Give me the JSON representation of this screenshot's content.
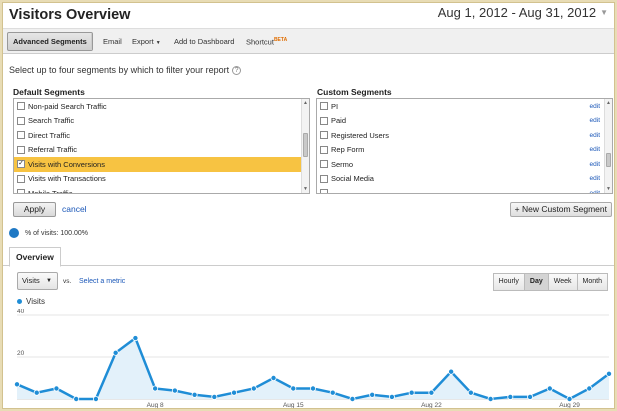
{
  "header": {
    "title": "Visitors Overview",
    "date_range": "Aug 1, 2012 - Aug 31, 2012"
  },
  "toolbar": {
    "advanced_segments": "Advanced Segments",
    "email": "Email",
    "export": "Export",
    "add_to_dashboard": "Add to Dashboard",
    "shortcut": "Shortcut",
    "beta": "BETA"
  },
  "segments": {
    "instruction": "Select up to four segments by which to filter your report",
    "default_heading": "Default Segments",
    "custom_heading": "Custom Segments",
    "default_items": [
      {
        "label": "Non-paid Search Traffic",
        "checked": false,
        "selected": false
      },
      {
        "label": "Search Traffic",
        "checked": false,
        "selected": false
      },
      {
        "label": "Direct Traffic",
        "checked": false,
        "selected": false
      },
      {
        "label": "Referral Traffic",
        "checked": false,
        "selected": false
      },
      {
        "label": "Visits with Conversions",
        "checked": true,
        "selected": true
      },
      {
        "label": "Visits with Transactions",
        "checked": false,
        "selected": false
      },
      {
        "label": "Mobile Traffic",
        "checked": false,
        "selected": false
      }
    ],
    "custom_items": [
      {
        "label": "PI",
        "edit": "edit"
      },
      {
        "label": "Paid",
        "edit": "edit"
      },
      {
        "label": "Registered Users",
        "edit": "edit"
      },
      {
        "label": "Rep Form",
        "edit": "edit"
      },
      {
        "label": "Sermo",
        "edit": "edit"
      },
      {
        "label": "Social Media",
        "edit": "edit"
      },
      {
        "label": "",
        "edit": "edit"
      }
    ],
    "apply": "Apply",
    "cancel": "cancel",
    "new_custom_segment": "+ New Custom Segment"
  },
  "summary": {
    "pct_visits": "% of visits: 100.00%"
  },
  "tabs": {
    "overview": "Overview"
  },
  "controls": {
    "metric": "Visits",
    "vs": "vs.",
    "select_metric": "Select a metric",
    "granularity": [
      "Hourly",
      "Day",
      "Week",
      "Month"
    ],
    "active_granularity": "Day"
  },
  "chart_data": {
    "type": "area",
    "series": [
      {
        "name": "Visits",
        "color": "#1f8dd6",
        "x": [
          "Aug 1",
          "Aug 2",
          "Aug 3",
          "Aug 4",
          "Aug 5",
          "Aug 6",
          "Aug 7",
          "Aug 8",
          "Aug 9",
          "Aug 10",
          "Aug 11",
          "Aug 12",
          "Aug 13",
          "Aug 14",
          "Aug 15",
          "Aug 16",
          "Aug 17",
          "Aug 18",
          "Aug 19",
          "Aug 20",
          "Aug 21",
          "Aug 22",
          "Aug 23",
          "Aug 24",
          "Aug 25",
          "Aug 26",
          "Aug 27",
          "Aug 28",
          "Aug 29",
          "Aug 30",
          "Aug 31"
        ],
        "values": [
          7,
          3,
          5,
          0,
          0,
          22,
          29,
          5,
          4,
          2,
          1,
          3,
          5,
          10,
          5,
          5,
          3,
          0,
          2,
          1,
          3,
          3,
          13,
          3,
          0,
          1,
          1,
          5,
          0,
          5,
          12
        ]
      }
    ],
    "y_ticks": [
      "20",
      "40"
    ],
    "x_ticks": [
      {
        "label": "Aug 8",
        "x": "Aug 8"
      },
      {
        "label": "Aug 15",
        "x": "Aug 15"
      },
      {
        "label": "Aug 22",
        "x": "Aug 22"
      },
      {
        "label": "Aug 29",
        "x": "Aug 29"
      }
    ],
    "ylim": [
      0,
      40
    ],
    "grid": true
  }
}
